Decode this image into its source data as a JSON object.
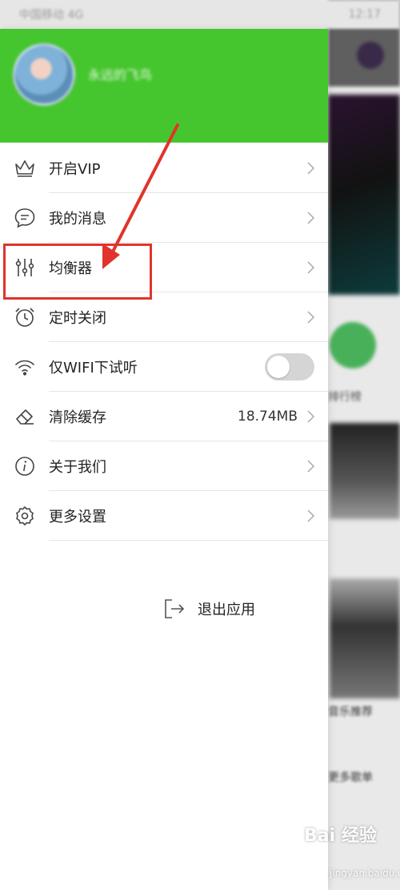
{
  "status_bar": {
    "left": "中国移动 4G",
    "right": "12:17"
  },
  "background": {
    "label_1": "排行榜",
    "label_2": "音乐推荐",
    "label_3": "更多歌单"
  },
  "drawer": {
    "user_name": "永远的飞鸟",
    "menu": [
      {
        "label": "开启VIP",
        "icon": "crown-icon"
      },
      {
        "label": "我的消息",
        "icon": "message-icon"
      },
      {
        "label": "均衡器",
        "icon": "equalizer-icon"
      },
      {
        "label": "定时关闭",
        "icon": "alarm-clock-icon"
      },
      {
        "label": "仅WIFI下试听",
        "icon": "wifi-icon",
        "toggle_on": false
      },
      {
        "label": "清除缓存",
        "icon": "eraser-icon",
        "value": "18.74MB"
      },
      {
        "label": "关于我们",
        "icon": "info-icon"
      },
      {
        "label": "更多设置",
        "icon": "gear-icon"
      }
    ],
    "exit_label": "退出应用"
  },
  "watermark": {
    "brand": "Bai 经验",
    "url": "jingyan.baidu.com"
  },
  "colors": {
    "header_green": "#46c62e",
    "annotation_red": "#e0342c"
  }
}
